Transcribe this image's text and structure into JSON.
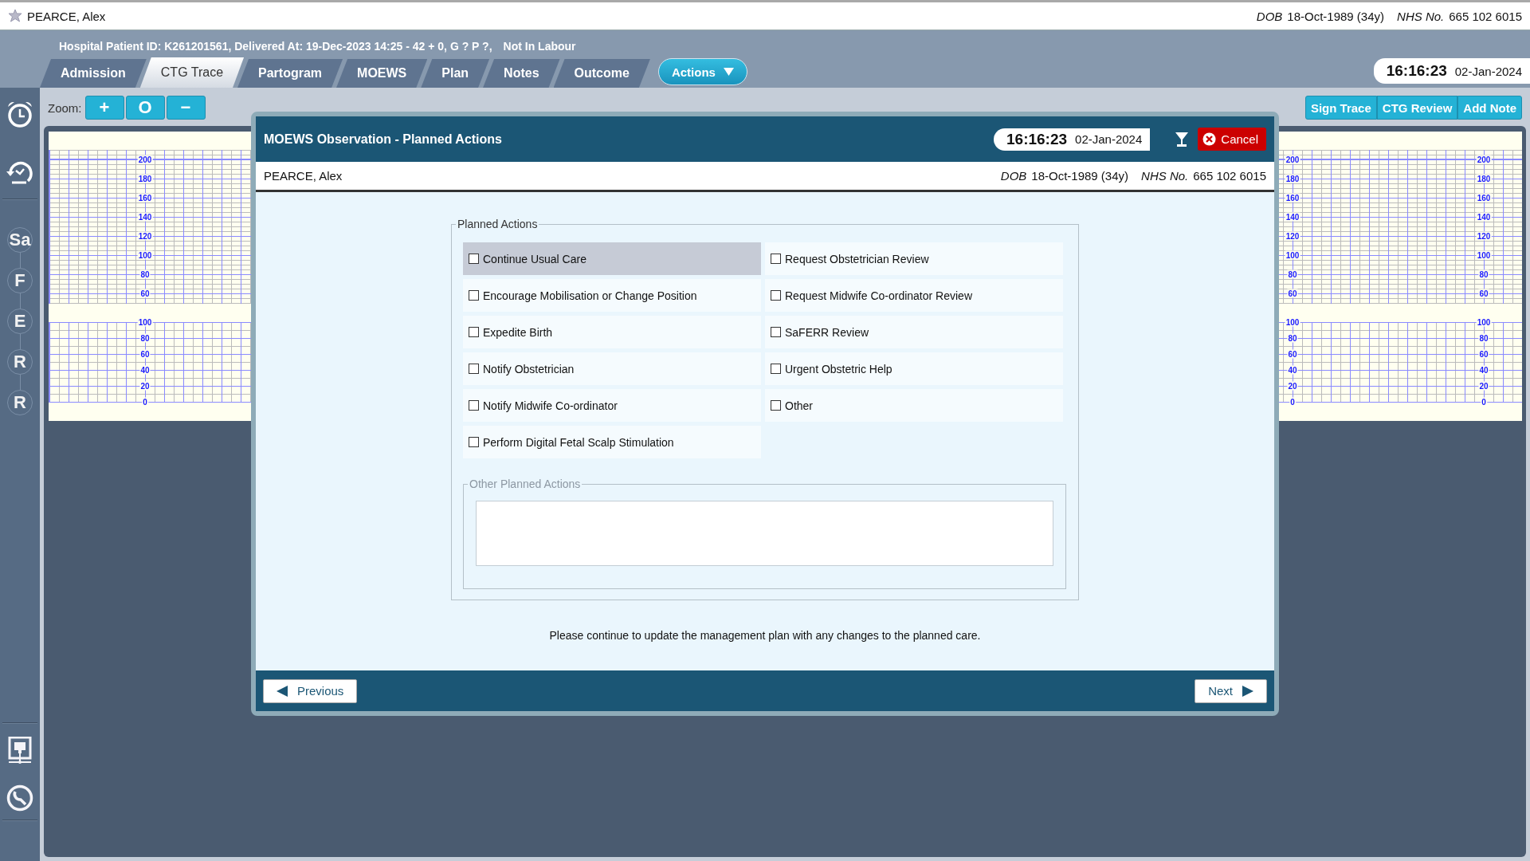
{
  "top_bar": {
    "patient_name": "PEARCE, Alex",
    "dob_label": "DOB",
    "dob": "18-Oct-1989 (34y)",
    "nhs_label": "NHS No.",
    "nhs": "665 102 6015"
  },
  "header": {
    "info": "Hospital Patient ID: K261201561, Delivered At: 19-Dec-2023 14:25 - 42 + 0, G ? P ?,",
    "status": "Not In Labour"
  },
  "tabs": [
    {
      "label": "Admission",
      "selected": false
    },
    {
      "label": "CTG Trace",
      "selected": true
    },
    {
      "label": "Partogram",
      "selected": false
    },
    {
      "label": "MOEWS",
      "selected": false
    },
    {
      "label": "Plan",
      "selected": false
    },
    {
      "label": "Notes",
      "selected": false
    },
    {
      "label": "Outcome",
      "selected": false
    }
  ],
  "actions_button": "Actions",
  "clock": {
    "time": "16:16:23",
    "date": "02-Jan-2024"
  },
  "sidebar": {
    "steps": [
      "Sa",
      "F",
      "E",
      "R",
      "R"
    ]
  },
  "toolbar": {
    "zoom_label": "Zoom:",
    "zoom_buttons": [
      "+",
      "O",
      "−"
    ],
    "buttons": [
      "Sign Trace",
      "CTG Review",
      "Add Note"
    ]
  },
  "ctg": {
    "scales": [
      {
        "fhr": [
          "200",
          "180",
          "160",
          "140",
          "120",
          "100",
          "80",
          "60"
        ],
        "toco": [
          "100",
          "80",
          "60",
          "40",
          "20",
          "0"
        ]
      },
      {
        "fhr": [
          "200",
          "180",
          "160",
          "140",
          "120",
          "100",
          "80",
          "60"
        ],
        "toco": [
          "100",
          "80",
          "60",
          "40",
          "20",
          "0"
        ]
      },
      {
        "fhr": [
          "200",
          "180",
          "160",
          "140",
          "120",
          "100",
          "80",
          "60"
        ],
        "toco": [
          "100",
          "80",
          "60",
          "40",
          "20",
          "0"
        ]
      }
    ]
  },
  "dialog": {
    "title": "MOEWS Observation - Planned Actions",
    "clock": {
      "time": "16:16:23",
      "date": "02-Jan-2024"
    },
    "cancel": "Cancel",
    "patient": {
      "name": "PEARCE, Alex",
      "dob_label": "DOB",
      "dob": "18-Oct-1989 (34y)",
      "nhs_label": "NHS No.",
      "nhs": "665 102 6015"
    },
    "group_legend": "Planned Actions",
    "actions": [
      {
        "label": "Continue Usual Care",
        "checked": false,
        "highlighted": true
      },
      {
        "label": "Request Obstetrician Review",
        "checked": false,
        "highlighted": false
      },
      {
        "label": "Encourage Mobilisation or Change Position",
        "checked": false,
        "highlighted": false
      },
      {
        "label": "Request Midwife Co-ordinator Review",
        "checked": false,
        "highlighted": false
      },
      {
        "label": "Expedite Birth",
        "checked": false,
        "highlighted": false
      },
      {
        "label": "SaFERR Review",
        "checked": false,
        "highlighted": false
      },
      {
        "label": "Notify Obstetrician",
        "checked": false,
        "highlighted": false
      },
      {
        "label": "Urgent Obstetric Help",
        "checked": false,
        "highlighted": false
      },
      {
        "label": "Notify Midwife Co-ordinator",
        "checked": false,
        "highlighted": false
      },
      {
        "label": "Other",
        "checked": false,
        "highlighted": false
      },
      {
        "label": "Perform Digital Fetal Scalp Stimulation",
        "checked": false,
        "highlighted": false
      }
    ],
    "other_legend": "Other Planned Actions",
    "message": "Please continue to update the management plan with any changes to the planned care.",
    "previous": "Previous",
    "next": "Next"
  }
}
